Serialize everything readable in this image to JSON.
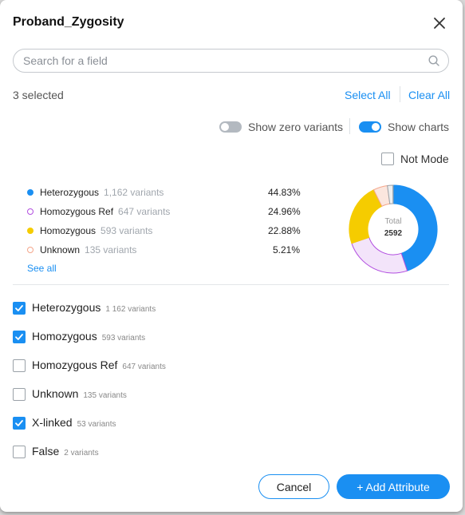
{
  "dialog": {
    "title": "Proband_Zygosity",
    "search_placeholder": "Search for a field",
    "selected_count": "3 selected",
    "select_all_label": "Select All",
    "clear_all_label": "Clear All",
    "show_zero_variants_label": "Show zero variants",
    "show_zero_variants_on": false,
    "show_charts_label": "Show charts",
    "show_charts_on": true,
    "not_mode_label": "Not Mode",
    "not_mode_checked": false
  },
  "legend": {
    "items": [
      {
        "name": "Heterozygous",
        "count": "1,162 variants",
        "percent": "44.83%",
        "color": "#1a8ff2",
        "hollow": false
      },
      {
        "name": "Homozygous Ref",
        "count": "647 variants",
        "percent": "24.96%",
        "color": "#b24fe0",
        "hollow": true
      },
      {
        "name": "Homozygous",
        "count": "593 variants",
        "percent": "22.88%",
        "color": "#f5cc00",
        "hollow": false
      },
      {
        "name": "Unknown",
        "count": "135 variants",
        "percent": "5.21%",
        "color": "#f4a58a",
        "hollow": true
      }
    ],
    "see_all_label": "See all"
  },
  "chart_data": {
    "type": "pie",
    "labels": [
      "Heterozygous",
      "Homozygous Ref",
      "Homozygous",
      "Unknown",
      "X-linked",
      "False"
    ],
    "values": [
      1162,
      647,
      593,
      135,
      53,
      2
    ],
    "center_label": "Total",
    "center_value": "2592",
    "colors": [
      "#1a8ff2",
      "#f3e4fa",
      "#f5cc00",
      "#fbe6de",
      "#eeeeee",
      "#eeeeee"
    ],
    "strokes": [
      "#1a8ff2",
      "#b24fe0",
      "#f5cc00",
      "#f4a58a",
      "#9aa1a8",
      "#9aa1a8"
    ]
  },
  "options": [
    {
      "label": "Heterozygous",
      "count": "1 162 variants",
      "checked": true
    },
    {
      "label": "Homozygous",
      "count": "593 variants",
      "checked": true
    },
    {
      "label": "Homozygous Ref",
      "count": "647 variants",
      "checked": false
    },
    {
      "label": "Unknown",
      "count": "135 variants",
      "checked": false
    },
    {
      "label": "X-linked",
      "count": "53 variants",
      "checked": true
    },
    {
      "label": "False",
      "count": "2 variants",
      "checked": false
    }
  ],
  "footer": {
    "cancel_label": "Cancel",
    "add_label": "+ Add Attribute"
  }
}
